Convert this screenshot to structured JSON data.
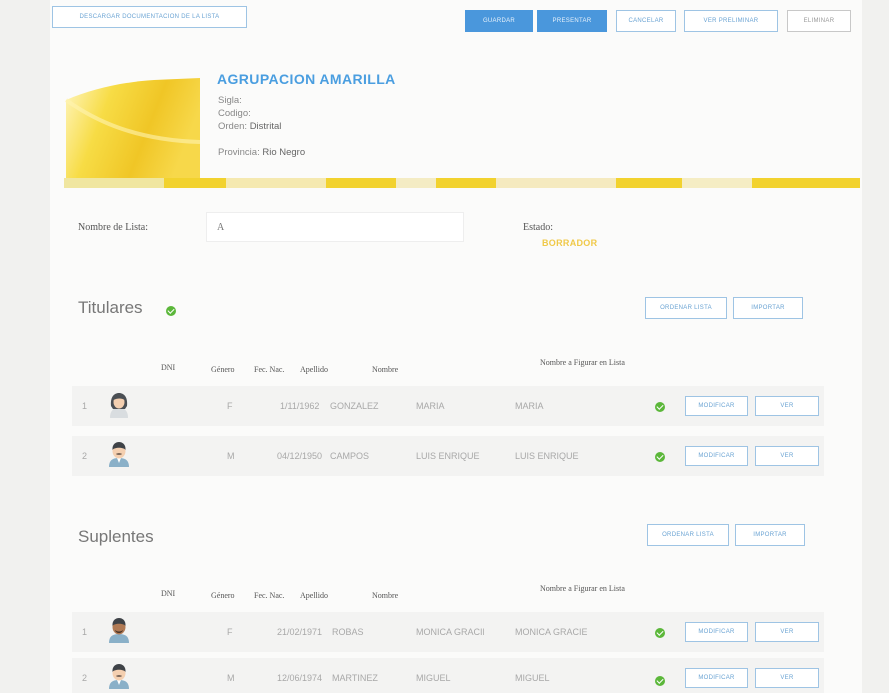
{
  "toolbar": {
    "download_label": "DESCARGAR DOCUMENTACION DE LA LISTA",
    "save_label": "GUARDAR",
    "present_label": "PRESENTAR",
    "cancel_label": "CANCELAR",
    "view_label": "VER PRELIMINAR",
    "delete_label": "ELIMINAR"
  },
  "agrupacion": {
    "name": "AGRUPACION AMARILLA",
    "sigla_label": "Sigla:",
    "codigo_label": "Codigo:",
    "orden_label": "Orden:",
    "orden_value": "Distrital",
    "provincia_label": "Provincia:",
    "provincia_value": "Rio Negro"
  },
  "form": {
    "list_name_label": "Nombre de Lista:",
    "list_name_value": "A",
    "state_label": "Estado:",
    "state_value": "BORRADOR"
  },
  "table_headers": {
    "dni": "DNI",
    "genero": "Género",
    "fec_nac": "Fec. Nac.",
    "apellido": "Apellido",
    "nombre": "Nombre",
    "nombre_figurar": "Nombre a Figurar en Lista"
  },
  "titulares": {
    "title": "Titulares",
    "order_label": "ORDENAR LISTA",
    "import_label": "IMPORTAR",
    "rows": [
      {
        "index": "1",
        "dni": "",
        "genero": "F",
        "fec_nac": "1/11/1962",
        "apellido": "GONZALEZ",
        "nombre": "MARIA",
        "figurar": "MARIA",
        "modify_label": "MODIFICAR",
        "view_label": "VER"
      },
      {
        "index": "2",
        "dni": "",
        "genero": "M",
        "fec_nac": "04/12/1950",
        "apellido": "CAMPOS",
        "nombre": "LUIS ENRIQUE",
        "figurar": "LUIS ENRIQUE",
        "modify_label": "MODIFICAR",
        "view_label": "VER"
      }
    ]
  },
  "suplentes": {
    "title": "Suplentes",
    "order_label": "ORDENAR LISTA",
    "import_label": "IMPORTAR",
    "rows": [
      {
        "index": "1",
        "dni": "",
        "genero": "F",
        "fec_nac": "21/02/1971",
        "apellido": "ROBAS",
        "nombre": "MONICA GRACIELA",
        "figurar": "MONICA GRACIELA",
        "modify_label": "MODIFICAR",
        "view_label": "VER"
      },
      {
        "index": "2",
        "dni": "",
        "genero": "M",
        "fec_nac": "12/06/1974",
        "apellido": "MARTINEZ",
        "nombre": "MIGUEL",
        "figurar": "MIGUEL",
        "modify_label": "MODIFICAR",
        "view_label": "VER"
      }
    ]
  },
  "colors": {
    "accent": "#4a97dc",
    "flag_yellow": "#f2d22e",
    "state_yellow": "#f0c948",
    "check_green": "#5bb73a"
  }
}
